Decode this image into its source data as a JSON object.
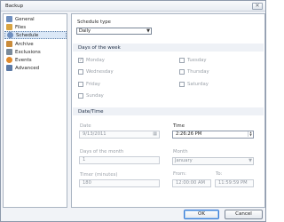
{
  "window": {
    "title": "Backup",
    "close_glyph": "✕"
  },
  "sidebar": {
    "items": [
      {
        "label": "General",
        "icon": "general-icon",
        "color": "#6f8fbf"
      },
      {
        "label": "Files",
        "icon": "files-icon",
        "color": "#d9a441"
      },
      {
        "label": "Schedule",
        "icon": "schedule-icon",
        "color": "#6f8fbf"
      },
      {
        "label": "Archive",
        "icon": "archive-icon",
        "color": "#c98b3a"
      },
      {
        "label": "Exclusions",
        "icon": "exclusions-icon",
        "color": "#7a8a9a"
      },
      {
        "label": "Events",
        "icon": "events-icon",
        "color": "#e08a2c"
      },
      {
        "label": "Advanced",
        "icon": "advanced-icon",
        "color": "#5c7aa6"
      }
    ],
    "selected_index": 2
  },
  "schedule": {
    "type_label": "Schedule type",
    "type_value": "Daily"
  },
  "days": {
    "title": "Days of the week",
    "items": [
      {
        "label": "Monday",
        "checked": true
      },
      {
        "label": "Wednesday",
        "checked": false
      },
      {
        "label": "Friday",
        "checked": false
      },
      {
        "label": "Sunday",
        "checked": false
      },
      {
        "label": "Tuesday",
        "checked": false
      },
      {
        "label": "Thursday",
        "checked": false
      },
      {
        "label": "Saturday",
        "checked": false
      }
    ]
  },
  "datetime": {
    "title": "Date/Time",
    "date_label": "Date",
    "date_value": "9/13/2011",
    "time_label": "Time",
    "time_value": "2:26:26 PM",
    "days_of_month_label": "Days of the month",
    "days_of_month_value": "1",
    "month_label": "Month",
    "month_value": "January",
    "timer_label": "Timer (minutes)",
    "timer_value": "180",
    "from_label": "From:",
    "from_value": "12:00:00 AM",
    "to_label": "To:",
    "to_value": "11:59:59 PM"
  },
  "footer": {
    "ok_label": "OK",
    "cancel_label": "Cancel"
  },
  "colors": {
    "accent": "#3a7bd5",
    "selection": "#dbe8f7"
  }
}
